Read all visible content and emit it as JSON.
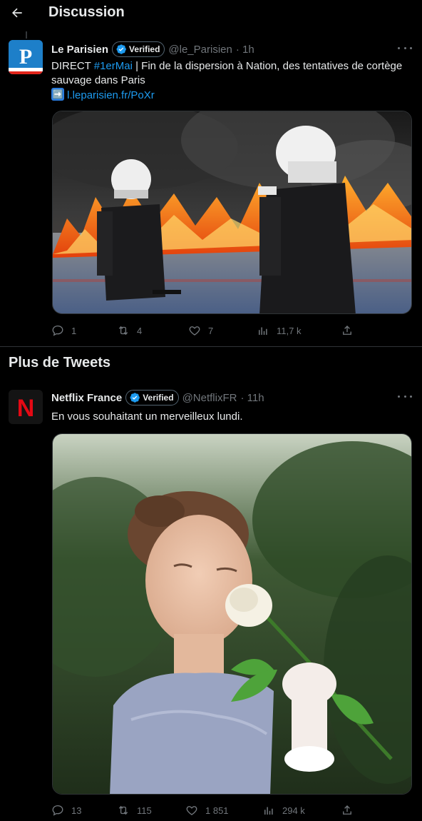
{
  "header": {
    "title": "Discussion"
  },
  "section_title": "Plus de Tweets",
  "tweets": [
    {
      "author": "Le Parisien",
      "verified_label": "Verified",
      "handle": "@le_Parisien",
      "time": "· 1h",
      "avatar_letter": "P",
      "text_prefix": "DIRECT ",
      "hashtag": "#1erMai",
      "text_main": " | Fin de la dispersion à Nation, des tentatives de cortège sauvage dans Paris",
      "link_emoji": "➡️",
      "link": "l.leparisien.fr/PoXr",
      "replies": "1",
      "retweets": "4",
      "likes": "7",
      "views": "11,7 k"
    },
    {
      "author": "Netflix France",
      "verified_label": "Verified",
      "handle": "@NetflixFR",
      "time": "· 11h",
      "avatar_letter": "N",
      "text": "En vous souhaitant un merveilleux lundi.",
      "replies": "13",
      "retweets": "115",
      "likes": "1 851",
      "views": "294 k"
    }
  ],
  "colors": {
    "accent": "#1d9bf0",
    "secondary": "#71767b",
    "netflix_red": "#e50914"
  }
}
